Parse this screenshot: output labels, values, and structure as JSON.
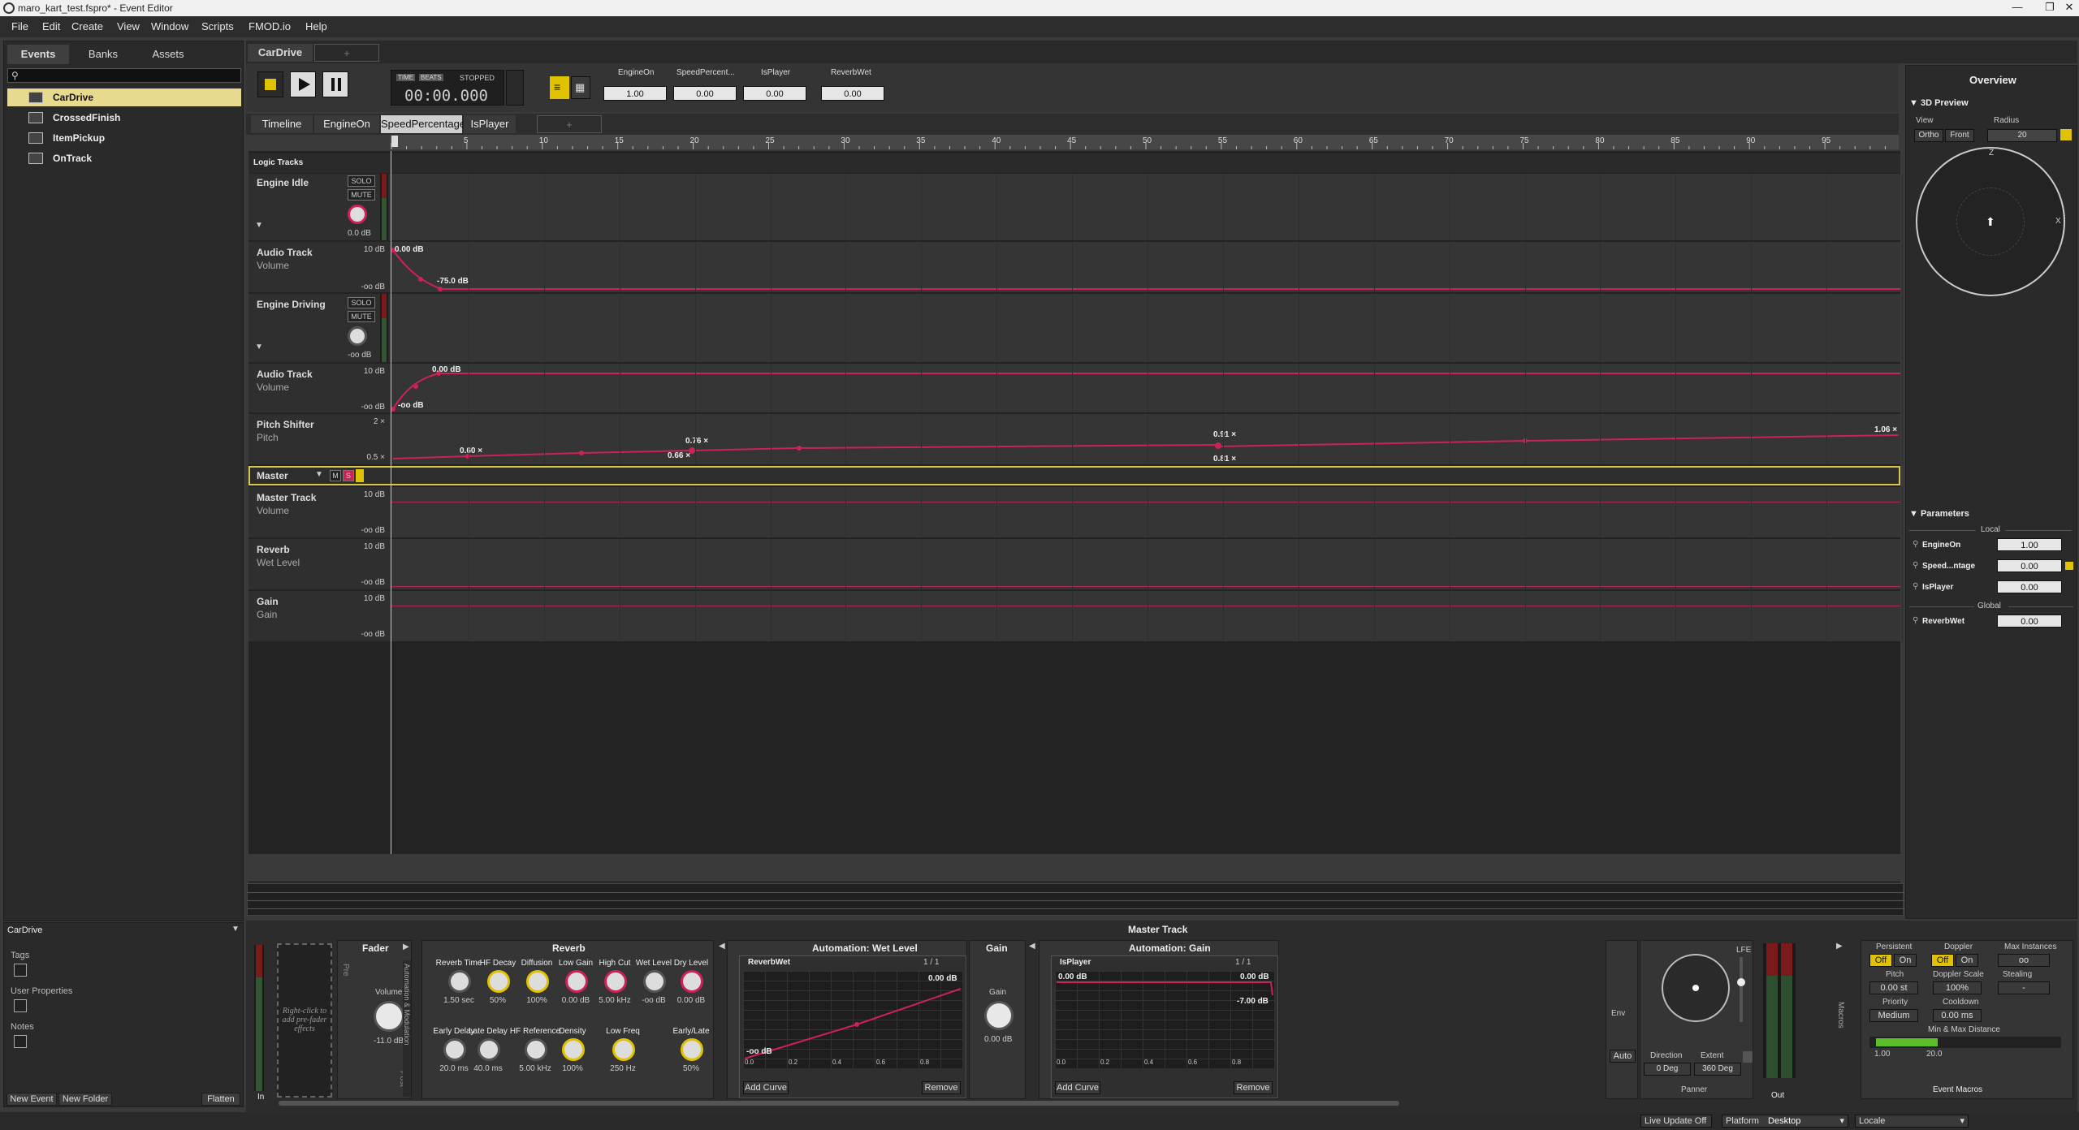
{
  "window": {
    "title": "maro_kart_test.fspro* - Event Editor",
    "controls": [
      "—",
      "❐",
      "✕"
    ]
  },
  "menu": [
    "File",
    "Edit",
    "Create",
    "View",
    "Window",
    "Scripts",
    "FMOD.io",
    "Help"
  ],
  "browser": {
    "tabs": [
      "Events",
      "Banks",
      "Assets"
    ],
    "events": [
      "CarDrive",
      "CrossedFinish",
      "ItemPickup",
      "OnTrack"
    ],
    "selected": "CarDrive"
  },
  "properties": {
    "header": "CarDrive",
    "tags": "Tags",
    "user_properties": "User Properties",
    "notes": "Notes",
    "new_event": "New Event",
    "new_folder": "New Folder",
    "flatten": "Flatten"
  },
  "editor": {
    "event_tab": "CarDrive",
    "add_tab": "+",
    "time_btn": "TIME",
    "beats_btn": "BEATS",
    "state": "STOPPED",
    "time": "00:00.000",
    "param_slots": [
      {
        "name": "EngineOn",
        "value": "1.00"
      },
      {
        "name": "SpeedPercent...",
        "value": "0.00"
      },
      {
        "name": "IsPlayer",
        "value": "0.00"
      },
      {
        "name": "ReverbWet",
        "value": "0.00"
      }
    ],
    "param_tabs": [
      "Timeline",
      "EngineOn",
      "SpeedPercentage",
      "IsPlayer",
      "+"
    ],
    "active_param_tab": "SpeedPercentage",
    "ruler_ticks": [
      "5",
      "10",
      "15",
      "20",
      "25",
      "30",
      "35",
      "40",
      "45",
      "50",
      "55",
      "60",
      "65",
      "70",
      "75",
      "80",
      "85",
      "90",
      "95"
    ],
    "logic_tracks": "Logic Tracks"
  },
  "tracks": {
    "engine_idle": {
      "name": "Engine Idle",
      "solo": "SOLO",
      "mute": "MUTE",
      "db": "0.0 dB"
    },
    "auto1": {
      "name": "Audio Track",
      "sub": "Volume",
      "top": "10 dB",
      "bottom": "-oo dB",
      "p1": "0.00 dB",
      "p2": "-75.0 dB"
    },
    "engine_driving": {
      "name": "Engine Driving",
      "solo": "SOLO",
      "mute": "MUTE",
      "db": "-oo dB"
    },
    "auto2": {
      "name": "Audio Track",
      "sub": "Volume",
      "top": "10 dB",
      "bottom": "-oo dB",
      "p1": "0.00 dB",
      "p2": "-oo dB"
    },
    "pitch": {
      "name": "Pitch Shifter",
      "sub": "Pitch",
      "top": "2 ×",
      "bottom": "0.5 ×",
      "labels": [
        "0.60 ×",
        "0.76 ×",
        "0.66 ×",
        "0.91 ×",
        "0.81 ×",
        "1.06 ×"
      ]
    },
    "master": {
      "name": "Master",
      "m": "M",
      "s": "S"
    },
    "master_track": {
      "name": "Master Track",
      "sub": "Volume",
      "top": "10 dB",
      "bottom": "-oo dB"
    },
    "reverb": {
      "name": "Reverb",
      "sub": "Wet Level",
      "top": "10 dB",
      "bottom": "-oo dB"
    },
    "gain": {
      "name": "Gain",
      "sub": "Gain",
      "top": "10 dB",
      "bottom": "-oo dB"
    }
  },
  "overview": {
    "title": "Overview",
    "preview3d": "3D Preview",
    "view": "View",
    "radius": "Radius",
    "ortho": "Ortho",
    "front": "Front",
    "radius_val": "20",
    "z": "Z",
    "x": "X",
    "parameters": "Parameters",
    "local": "Local",
    "global": "Global",
    "params": [
      {
        "name": "EngineOn",
        "value": "1.00"
      },
      {
        "name": "Speed...ntage",
        "value": "0.00"
      },
      {
        "name": "IsPlayer",
        "value": "0.00"
      }
    ],
    "global_params": [
      {
        "name": "ReverbWet",
        "value": "0.00"
      }
    ]
  },
  "deck": {
    "title": "Master Track",
    "effects_hint": "Right-click to add pre-fader effects",
    "in": "In",
    "fader": "Fader",
    "pre": "Pre",
    "post": "Post",
    "volume": "Volume",
    "volume_val": "-11.0 dB",
    "auto_mod": "Automation & Modulation",
    "reverb": "Reverb",
    "reverb_knobs": [
      {
        "label": "Reverb Time",
        "value": "1.50 sec"
      },
      {
        "label": "HF Decay",
        "value": "50%"
      },
      {
        "label": "Diffusion",
        "value": "100%"
      },
      {
        "label": "Low Gain",
        "value": "0.00 dB"
      },
      {
        "label": "High Cut",
        "value": "5.00 kHz"
      },
      {
        "label": "Wet Level",
        "value": "-oo dB"
      },
      {
        "label": "Dry Level",
        "value": "0.00 dB"
      }
    ],
    "reverb_knobs2": [
      {
        "label": "Early Delay",
        "value": "20.0 ms"
      },
      {
        "label": "Late Delay",
        "value": "40.0 ms"
      },
      {
        "label": "HF Reference",
        "value": "5.00 kHz"
      },
      {
        "label": "Density",
        "value": "100%"
      },
      {
        "label": "Low Freq",
        "value": "250 Hz"
      },
      {
        "label": "Early/Late",
        "value": "50%"
      }
    ],
    "auto_wet": "Automation: Wet Level",
    "reverbwet": "ReverbWet",
    "page1": "1 / 1",
    "wet_top": "0.00 dB",
    "wet_bottom": "-oo dB",
    "add_curve": "Add Curve",
    "remove": "Remove",
    "axis": [
      "0.0",
      "0.2",
      "0.4",
      "0.6",
      "0.8"
    ],
    "gain": "Gain",
    "gain_lbl": "Gain",
    "gain_val": "0.00 dB",
    "auto_gain": "Automation: Gain",
    "isplayer": "IsPlayer",
    "g_top_l": "0.00 dB",
    "g_top_r": "0.00 dB",
    "g_right": "-7.00 dB",
    "env": "Env",
    "auto": "Auto",
    "lfe": "LFE",
    "direction": "Direction",
    "extent": "Extent",
    "dir_val": "0 Deg",
    "ext_val": "360 Deg",
    "panner": "Panner",
    "out": "Out",
    "macros": "Macros",
    "persistent": "Persistent",
    "doppler": "Doppler",
    "max_inst": "Max Instances",
    "off": "Off",
    "on": "On",
    "inf": "oo",
    "pitch": "Pitch",
    "doppler_scale": "Doppler Scale",
    "stealing": "Stealing",
    "pitch_val": "0.00 st",
    "ds_val": "100%",
    "steal_val": "-",
    "priority": "Priority",
    "cooldown": "Cooldown",
    "prio_val": "Medium",
    "cool_val": "0.00 ms",
    "minmax": "Min & Max Distance",
    "minv": "1.00",
    "maxv": "20.0",
    "event_macros": "Event Macros"
  },
  "status": {
    "live": "Live Update Off",
    "platform": "Platform",
    "desktop": "Desktop",
    "locale": "Locale"
  },
  "colors": {
    "accent": "#cc2255",
    "selection": "#e7d98e",
    "master_border": "#d6c74a",
    "record": "#e0c200"
  }
}
